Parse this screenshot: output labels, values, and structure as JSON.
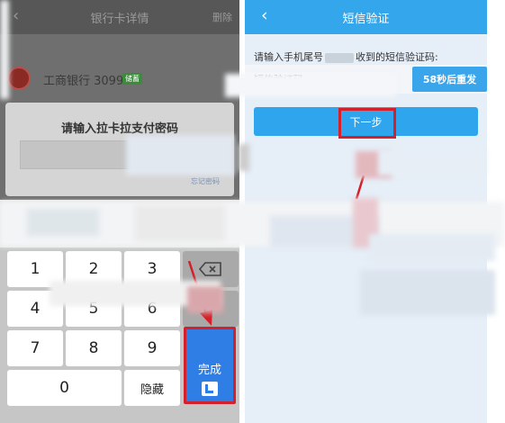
{
  "left_screen": {
    "header": {
      "back_icon": "chevron-left-icon",
      "title": "银行卡详情",
      "manage": "删除"
    },
    "bank_card": {
      "name": "工商银行 3099",
      "badge": "储蓄"
    },
    "payment_dialog": {
      "title": "请输入拉卡拉支付密码",
      "hint_link": "忘记密码"
    },
    "keypad": {
      "keys": [
        "1",
        "2",
        "3",
        "4",
        "5",
        "6",
        "7",
        "8",
        "9",
        "0"
      ],
      "delete_icon": "backspace-icon",
      "done_label": "完成",
      "done_logo_icon": "lakala-logo-icon",
      "hide_label": "隐藏"
    }
  },
  "right_screen": {
    "header": {
      "back_icon": "chevron-left-icon",
      "title": "短信验证"
    },
    "sms_prompt_before": "请输入手机尾号",
    "sms_prompt_after": "收到的短信验证码:",
    "code_input_placeholder": "短信验证码",
    "resend_button": "58秒后重发",
    "next_button": "下一步"
  },
  "colors": {
    "left_header_bg": "#575757",
    "right_header_bg": "#33a6ec",
    "primary_blue": "#2ea5ed",
    "highlight_red": "#d4202a"
  }
}
